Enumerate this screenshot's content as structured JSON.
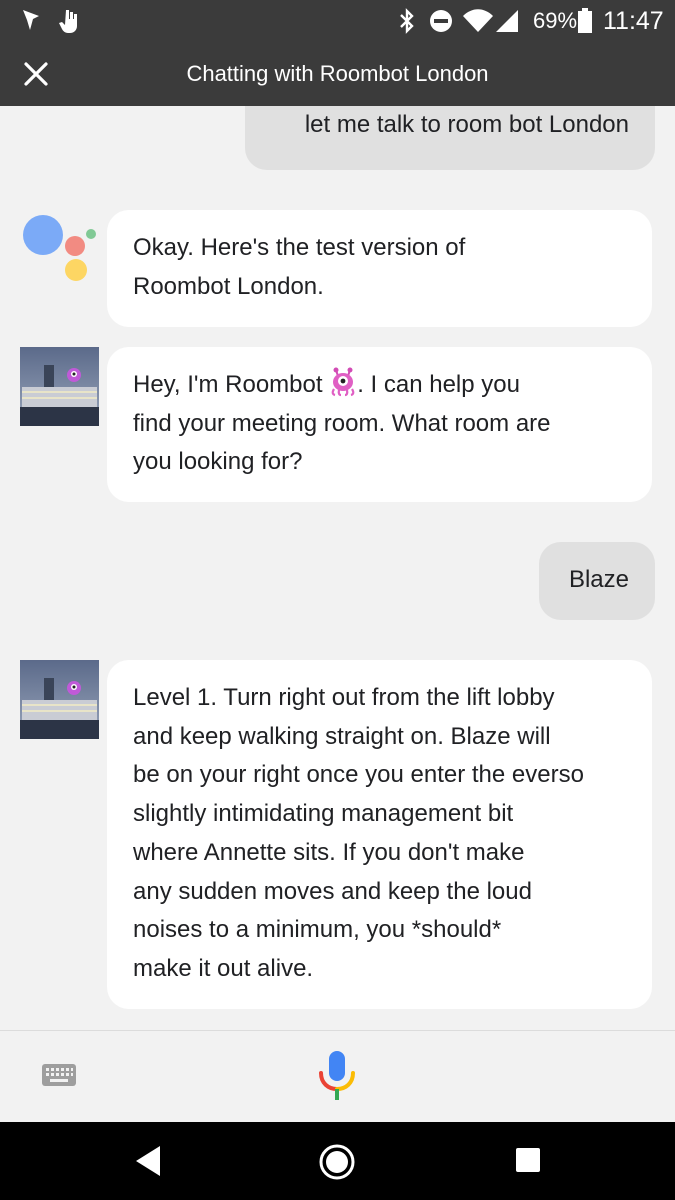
{
  "status_bar": {
    "battery_percent": "69%",
    "time": "11:47",
    "icons": [
      "map-pin-notification-icon",
      "hand-notification-icon",
      "bluetooth-icon",
      "do-not-disturb-icon",
      "wifi-icon",
      "cell-signal-icon",
      "battery-icon"
    ]
  },
  "app_bar": {
    "title": "Chatting with Roombot London",
    "close_icon": "close-icon"
  },
  "messages": [
    {
      "from": "user",
      "lines": [
        "let me talk to room bot London"
      ]
    },
    {
      "from": "assistant",
      "lines": [
        "Okay. Here's the test version of",
        "Roombot London."
      ]
    },
    {
      "from": "roombot",
      "lines_before_emoji": "Hey, I'm Roombot ",
      "emoji": "alien-monster-icon",
      "lines_after_emoji": ". I can help you",
      "lines": [
        "find your meeting room. What room are",
        "you looking for?"
      ]
    },
    {
      "from": "user",
      "lines": [
        "Blaze"
      ]
    },
    {
      "from": "roombot",
      "lines": [
        "Level 1. Turn right out from the lift lobby",
        "and keep walking straight on. Blaze will",
        "be on your right once you enter the everso",
        "slightly intimidating management bit",
        "where Annette sits. If you don't make",
        "any sudden moves and keep the loud",
        "noises to a minimum, you *should*",
        "make it out alive."
      ]
    }
  ],
  "input_bar": {
    "keyboard_icon": "keyboard-icon",
    "mic_icon": "microphone-icon"
  },
  "nav_bar": {
    "back_icon": "back-icon",
    "home_icon": "home-icon",
    "recents_icon": "recents-icon"
  },
  "colors": {
    "app_bar": "#3b3b3b",
    "background": "#f2f2f2",
    "user_bubble": "#e0e0e0",
    "bot_bubble": "#ffffff",
    "google_blue": "#4285f4",
    "google_red": "#ea4335",
    "google_yellow": "#fbbc05",
    "google_green": "#34a853"
  }
}
